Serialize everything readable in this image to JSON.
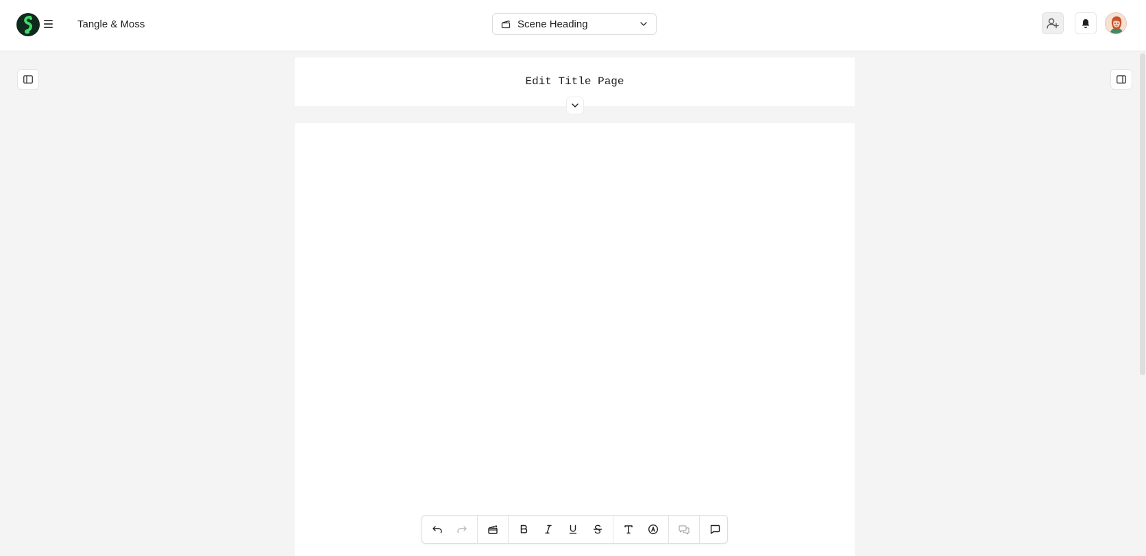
{
  "header": {
    "project_title": "Tangle & Moss",
    "element_select": {
      "selected": "Scene Heading"
    }
  },
  "title_page": {
    "label": "Edit Title Page"
  },
  "icons": {
    "logo": "app-logo",
    "menu": "hamburger-icon",
    "element": "clapperboard-icon",
    "chevron": "chevron-down-icon",
    "invite": "add-user-icon",
    "notifications": "bell-icon",
    "left_panel": "left-sidebar-toggle-icon",
    "right_panel": "right-sidebar-toggle-icon"
  },
  "toolbar": {
    "groups": [
      [
        "undo-icon",
        "redo-icon"
      ],
      [
        "clapperboard-icon"
      ],
      [
        "bold-icon",
        "italic-icon",
        "underline-icon",
        "strikethrough-icon"
      ],
      [
        "text-style-icon",
        "mention-icon"
      ],
      [
        "comments-icon"
      ],
      [
        "comment-icon"
      ]
    ]
  },
  "colors": {
    "logo_bg": "#0f2a1c",
    "logo_accent": "#3ddc6a",
    "page_bg": "#f4f4f4",
    "card_bg": "#ffffff"
  }
}
